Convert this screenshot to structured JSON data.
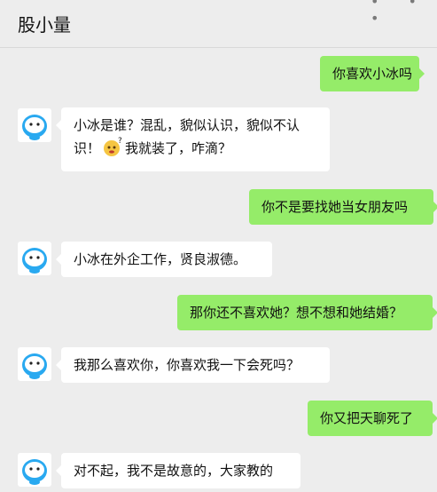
{
  "header": {
    "title": "股小量",
    "menu_icon": "more-dots-icon"
  },
  "messages": [
    {
      "sender": "me",
      "text": "你喜欢小冰吗"
    },
    {
      "sender": "bot",
      "lines": [
        "小冰是谁？混乱，貌似认识，貌似不认",
        "识！",
        "我就装了，咋滴？"
      ],
      "emoji": "confused-face-emoji"
    },
    {
      "sender": "me",
      "text": "你不是要找她当女朋友吗"
    },
    {
      "sender": "bot",
      "text": "小冰在外企工作，贤良淑德。"
    },
    {
      "sender": "me",
      "text": "那你还不喜欢她？想不想和她结婚？"
    },
    {
      "sender": "bot",
      "text": "我那么喜欢你，你喜欢我一下会死吗？"
    },
    {
      "sender": "me",
      "text": "你又把天聊死了"
    },
    {
      "sender": "bot",
      "text": "对不起，我不是故意的，大家教的"
    }
  ],
  "avatar_icon": "robot-avatar-icon",
  "colors": {
    "background": "#ededed",
    "my_bubble": "#95ec69",
    "bot_bubble": "#ffffff",
    "avatar_accent": "#29a9f0"
  }
}
